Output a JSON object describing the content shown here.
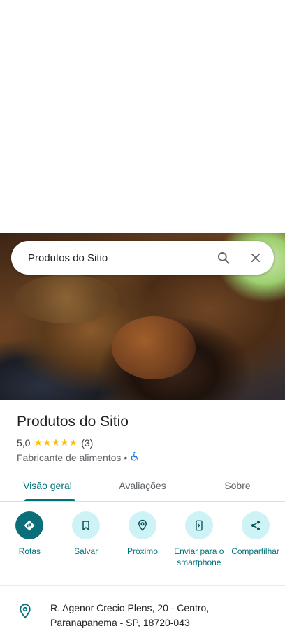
{
  "search": {
    "query": "Produtos do Sitio"
  },
  "place": {
    "name": "Produtos do Sitio",
    "rating": "5,0",
    "stars": "★★★★★",
    "review_count": "(3)",
    "category": "Fabricante de alimentos",
    "separator": "•"
  },
  "tabs": [
    {
      "label": "Visão geral",
      "active": true
    },
    {
      "label": "Avaliações",
      "active": false
    },
    {
      "label": "Sobre",
      "active": false
    }
  ],
  "actions": [
    {
      "label": "Rotas",
      "icon": "directions-icon"
    },
    {
      "label": "Salvar",
      "icon": "bookmark-icon"
    },
    {
      "label": "Próximo",
      "icon": "nearby-icon"
    },
    {
      "label": "Enviar para o smartphone",
      "icon": "send-to-phone-icon"
    },
    {
      "label": "Compartilhar",
      "icon": "share-icon"
    }
  ],
  "address": {
    "line1": "R. Agenor Crecio Plens, 20 - Centro,",
    "line2": "Paranapanema - SP, 18720-043"
  },
  "colors": {
    "accent": "#00737a",
    "action_bg": "#cef3f6",
    "primary_action_bg": "#0b6f7a",
    "star": "#fbbc04"
  }
}
